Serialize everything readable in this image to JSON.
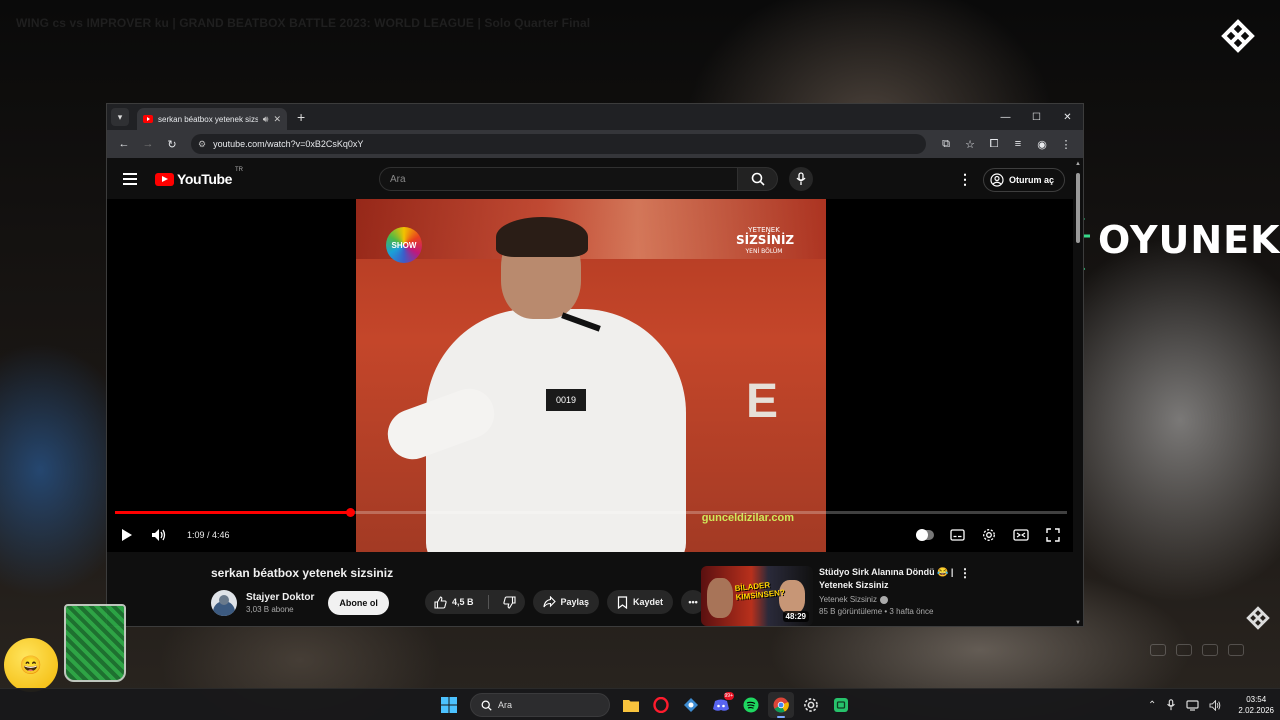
{
  "stream": {
    "title": "WING cs vs IMPROVER ku | GRAND BEATBOX BATTLE 2023: WORLD LEAGUE | Solo Quarter Final",
    "brand": "OYUNEKS"
  },
  "browser": {
    "tab_title": "serkan béatbox yetenek sizsiniz",
    "url": "youtube.com/watch?v=0xB2CsKq0xY"
  },
  "youtube": {
    "logo_text": "YouTube",
    "region": "TR",
    "search_placeholder": "Ara",
    "signin_label": "Oturum aç",
    "player": {
      "time": "1:09 / 4:46",
      "progress": 0.247,
      "video_overlay": {
        "channel_logo": "SHOW",
        "show_logo_line1": "YETENEK",
        "show_logo_line2": "SİZSİNİZ",
        "show_logo_line3": "YENİ BÖLÜM",
        "contestant_number": "0019",
        "watermark": "gunceldizilar.com"
      }
    },
    "video": {
      "title": "serkan béatbox yetenek sizsiniz",
      "channel": "Stajyer Doktor",
      "subscribers": "3,03 B abone",
      "subscribe_label": "Abone ol",
      "likes": "4,5 B",
      "share_label": "Paylaş",
      "save_label": "Kaydet"
    },
    "recommendation": {
      "title": "Stüdyo Sirk Alanına Döndü 😂 | Yetenek Sizsiniz",
      "channel": "Yetenek Sizsiniz",
      "meta": "85 B görüntüleme • 3 hafta önce",
      "duration": "48:29",
      "thumb_text": "BİLADER KİMSİNSEN?"
    }
  },
  "taskbar": {
    "search_placeholder": "Ara",
    "discord_badge": "99+",
    "time": "03:54",
    "date": "2.02.2026"
  },
  "colors": {
    "accent_red": "#ff0000",
    "brand_green": "#38d98a"
  }
}
